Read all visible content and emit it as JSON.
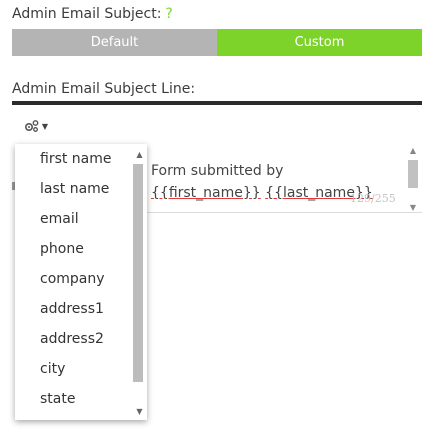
{
  "subject_field": {
    "label": "Admin Email Subject:",
    "help": "?",
    "options": {
      "default": "Default",
      "custom": "Custom"
    },
    "selected": "Custom"
  },
  "subject_line": {
    "label": "Admin Email Subject Line:",
    "toolbar": {
      "merge_tags_icon": "gears-icon"
    },
    "editor": {
      "line1": "Form submitted by",
      "tag1": "{{first_name}}",
      "tag2": "{{last_name}}",
      "counter": "129/255"
    }
  },
  "merge_menu": {
    "items": [
      "first name",
      "last name",
      "email",
      "phone",
      "company",
      "address1",
      "address2",
      "city",
      "state"
    ]
  },
  "colors": {
    "accent": "#7ed32a",
    "default_bg": "#b4b4b4"
  }
}
